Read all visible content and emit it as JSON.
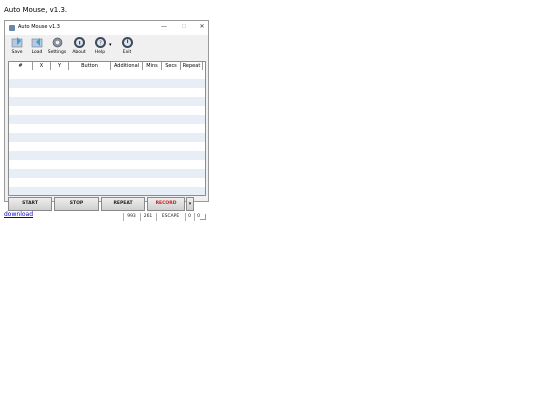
{
  "page": {
    "heading": "Auto Mouse, v1.3.",
    "download_label": "download"
  },
  "window": {
    "title": "Auto Mouse v1.3",
    "min": "—",
    "max": "☐",
    "close": "✕"
  },
  "toolbar": {
    "save": "Save",
    "load": "Load",
    "settings": "Settings",
    "about": "About",
    "help": "Help",
    "help_dropdown": "▾",
    "exit": "Exit"
  },
  "grid": {
    "columns": [
      "#",
      "X",
      "Y",
      "Button",
      "Additional",
      "Mins",
      "Secs",
      "Repeat"
    ],
    "row_count": 14
  },
  "actions": {
    "start": "START",
    "stop": "STOP",
    "repeat": "REPEAT",
    "record": "RECORD",
    "record_dropdown": "▾"
  },
  "status": {
    "x": "993",
    "y": "261",
    "key": "ESCAPE",
    "field4": "0",
    "field5": "0"
  },
  "colors": {
    "record_text": "#c02020",
    "row_alt": "#e8eef5"
  }
}
